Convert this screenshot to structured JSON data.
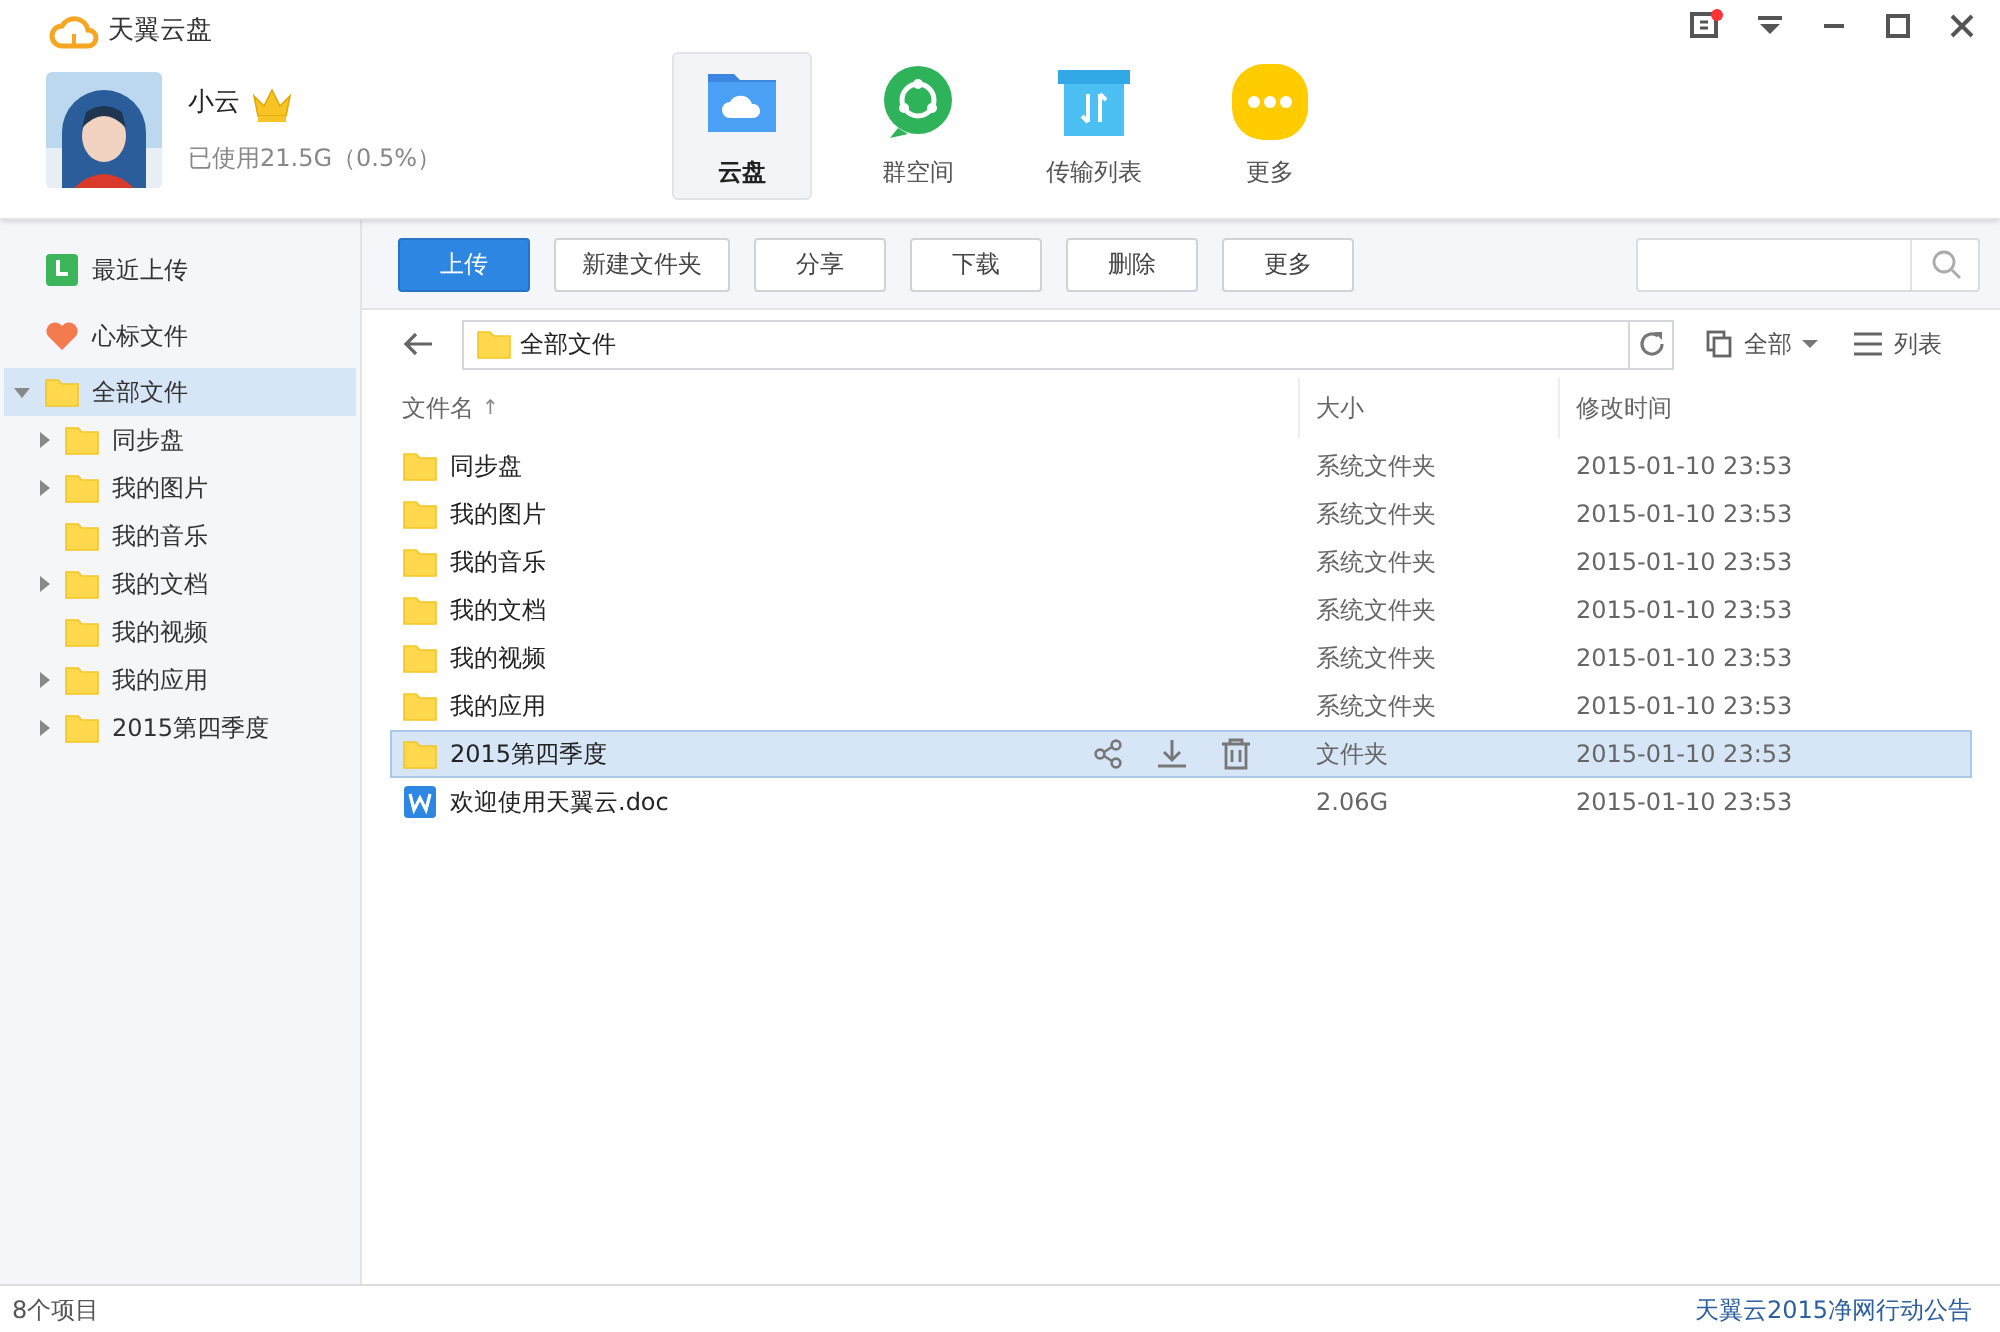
{
  "app": {
    "title": "天翼云盘"
  },
  "user": {
    "name": "小云",
    "vip": true,
    "usage": "已使用21.5G（0.5%）"
  },
  "nav_tabs": [
    {
      "label": "云盘",
      "kind": "cloud",
      "selected": true
    },
    {
      "label": "群空间",
      "kind": "group",
      "selected": false
    },
    {
      "label": "传输列表",
      "kind": "transfer",
      "selected": false
    },
    {
      "label": "更多",
      "kind": "more",
      "selected": false
    }
  ],
  "sidebar": {
    "quick": [
      {
        "label": "最近上传",
        "kind": "recent"
      },
      {
        "label": "心标文件",
        "kind": "favorite"
      }
    ],
    "tree": {
      "label": "全部文件",
      "expanded": true,
      "selected": true,
      "children": [
        {
          "label": "同步盘",
          "expandable": true,
          "selected": false
        },
        {
          "label": "我的图片",
          "expandable": true,
          "selected": false
        },
        {
          "label": "我的音乐",
          "expandable": false,
          "selected": false
        },
        {
          "label": "我的文档",
          "expandable": true,
          "selected": false
        },
        {
          "label": "我的视频",
          "expandable": false,
          "selected": false
        },
        {
          "label": "我的应用",
          "expandable": true,
          "selected": false
        },
        {
          "label": "2015第四季度",
          "expandable": true,
          "selected": false
        }
      ]
    }
  },
  "toolbar": {
    "buttons": [
      {
        "label": "上传",
        "primary": true
      },
      {
        "label": "新建文件夹",
        "primary": false
      },
      {
        "label": "分享",
        "primary": false
      },
      {
        "label": "下载",
        "primary": false
      },
      {
        "label": "删除",
        "primary": false
      },
      {
        "label": "更多",
        "primary": false
      }
    ]
  },
  "path_bar": {
    "path": "全部文件",
    "filter": "全部",
    "view": "列表"
  },
  "table": {
    "columns": [
      {
        "label": "文件名",
        "sort_indicator": "↑"
      },
      {
        "label": "大小"
      },
      {
        "label": "修改时间"
      }
    ],
    "rows": [
      {
        "kind": "folder",
        "name": "同步盘",
        "size": "系统文件夹",
        "modified": "2015-01-10 23:53",
        "selected": false
      },
      {
        "kind": "folder",
        "name": "我的图片",
        "size": "系统文件夹",
        "modified": "2015-01-10 23:53",
        "selected": false
      },
      {
        "kind": "folder",
        "name": "我的音乐",
        "size": "系统文件夹",
        "modified": "2015-01-10 23:53",
        "selected": false
      },
      {
        "kind": "folder",
        "name": "我的文档",
        "size": "系统文件夹",
        "modified": "2015-01-10 23:53",
        "selected": false
      },
      {
        "kind": "folder",
        "name": "我的视频",
        "size": "系统文件夹",
        "modified": "2015-01-10 23:53",
        "selected": false
      },
      {
        "kind": "folder",
        "name": "我的应用",
        "size": "系统文件夹",
        "modified": "2015-01-10 23:53",
        "selected": false
      },
      {
        "kind": "folder",
        "name": "2015第四季度",
        "size": "文件夹",
        "modified": "2015-01-10 23:53",
        "selected": true
      },
      {
        "kind": "doc",
        "name": "欢迎使用天翼云.doc",
        "size": "2.06G",
        "modified": "2015-01-10 23:53",
        "selected": false
      }
    ]
  },
  "status_bar": {
    "count": "8个项目",
    "notice": "天翼云2015净网行动公告"
  }
}
